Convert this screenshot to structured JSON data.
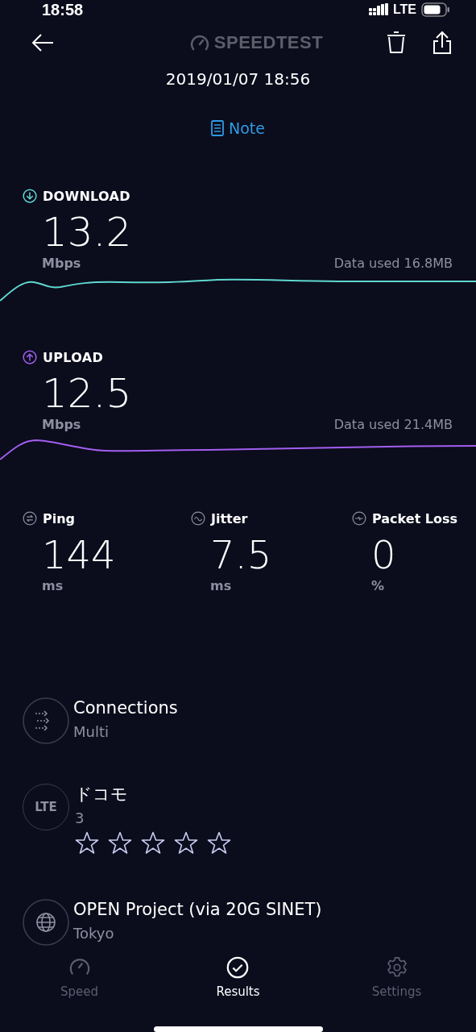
{
  "status_bar": {
    "time": "18:58",
    "network": "LTE"
  },
  "header": {
    "logo": "SPEEDTEST",
    "date": "2019/01/07 18:56",
    "note_link": "Note"
  },
  "speeds": [
    {
      "kind": "download",
      "label": "DOWNLOAD",
      "value": "13.2",
      "unit": "Mbps",
      "data_used": "Data used 16.8MB",
      "color": "#5fd8cf"
    },
    {
      "kind": "upload",
      "label": "UPLOAD",
      "value": "12.5",
      "unit": "Mbps",
      "data_used": "Data used 21.4MB",
      "color": "#a35ef0"
    }
  ],
  "metrics": [
    {
      "kind": "ping",
      "label": "Ping",
      "value": "144",
      "unit": "ms"
    },
    {
      "kind": "jitter",
      "label": "Jitter",
      "value": "7.5",
      "unit": "ms"
    },
    {
      "kind": "packet_loss",
      "label": "Packet Loss",
      "value": "0",
      "unit": "%"
    }
  ],
  "details": [
    {
      "kind": "connections",
      "title": "Connections",
      "subtitle": "Multi"
    },
    {
      "kind": "carrier",
      "badge": "LTE",
      "title": "ドコモ",
      "subtitle": "3",
      "stars": 0
    },
    {
      "kind": "server",
      "title": "OPEN Project (via 20G SINET)",
      "subtitle": "Tokyo"
    }
  ],
  "tabs": [
    {
      "kind": "speed",
      "label": "Speed",
      "selected": false
    },
    {
      "kind": "results",
      "label": "Results",
      "selected": true
    },
    {
      "kind": "settings",
      "label": "Settings",
      "selected": false
    }
  ]
}
